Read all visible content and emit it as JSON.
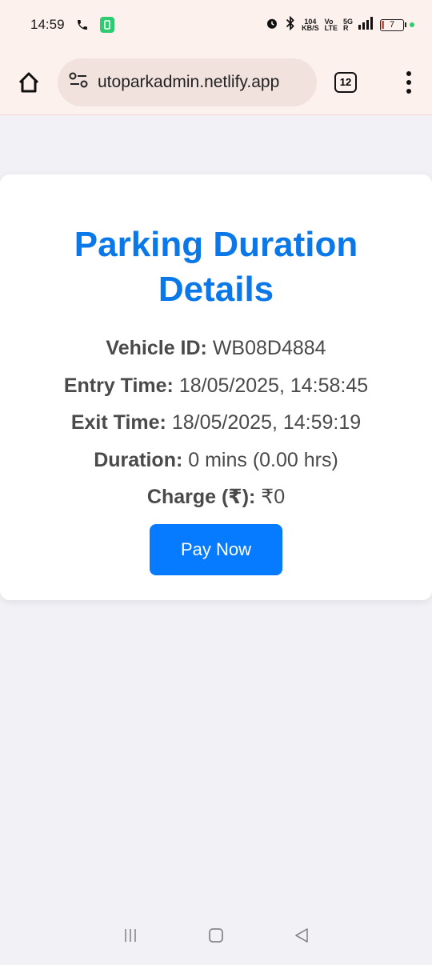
{
  "status_bar": {
    "time": "14:59",
    "speed_value": "104",
    "speed_unit": "KB/S",
    "volte_top": "Vo",
    "volte_bottom": "LTE",
    "network": "5G",
    "network_sub": "R",
    "battery": "7",
    "icons": [
      "phone-icon",
      "app-notification-icon",
      "alarm-icon",
      "bluetooth-icon",
      "signal-icon",
      "battery-icon"
    ]
  },
  "browser": {
    "url": "utoparkadmin.netlify.app",
    "tab_count": "12",
    "icons": [
      "home-icon",
      "site-settings-icon",
      "tabs-icon",
      "menu-icon"
    ]
  },
  "card": {
    "title": "Parking Duration Details",
    "vehicle_label": "Vehicle ID:",
    "vehicle_value": "WB08D4884",
    "entry_label": "Entry Time:",
    "entry_value": "18/05/2025, 14:58:45",
    "exit_label": "Exit Time:",
    "exit_value": "18/05/2025, 14:59:19",
    "duration_label": "Duration:",
    "duration_value": "0 mins (0.00 hrs)",
    "charge_label": "Charge (₹):",
    "charge_value": "₹0",
    "pay_button": "Pay Now",
    "accent_color": "#0a78e8",
    "button_color": "#077bff"
  },
  "nav_bar": {
    "icons": [
      "recent-apps-icon",
      "home-nav-icon",
      "back-icon"
    ]
  }
}
